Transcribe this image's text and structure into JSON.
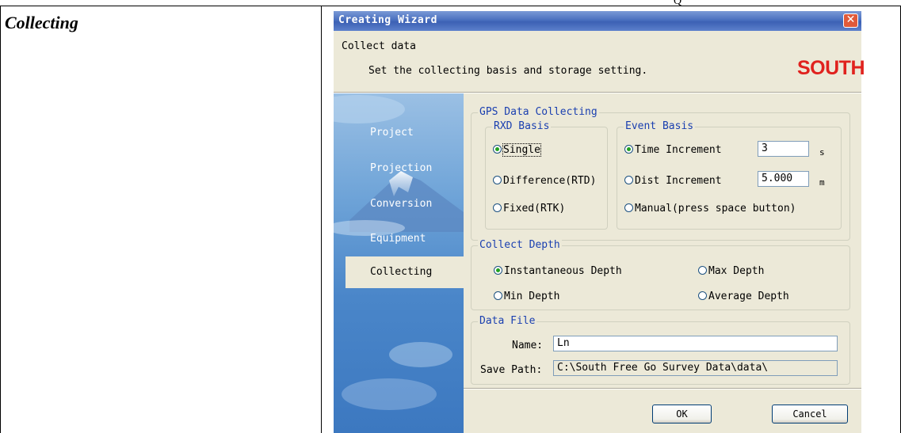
{
  "document": {
    "section_title": "Collecting",
    "top_fragment": "Q"
  },
  "dialog": {
    "title": "Creating Wizard",
    "close_glyph": "✕",
    "header_title": "Collect data",
    "header_subtitle": "Set the collecting basis and storage setting.",
    "logo_text": "SOUTH",
    "brand_color": "#e0221e",
    "nav": {
      "items": [
        {
          "label": "Project",
          "active": false
        },
        {
          "label": "Projection",
          "active": false
        },
        {
          "label": "Conversion",
          "active": false
        },
        {
          "label": "Equipment",
          "active": false
        },
        {
          "label": "Collecting",
          "active": true
        }
      ]
    },
    "gps": {
      "group_label": "GPS Data Collecting",
      "rxd": {
        "label": "RXD Basis",
        "options": [
          {
            "label": "Single",
            "selected": true
          },
          {
            "label": "Difference(RTD)",
            "selected": false
          },
          {
            "label": "Fixed(RTK)",
            "selected": false
          }
        ]
      },
      "event": {
        "label": "Event Basis",
        "time_label": "Time Increment",
        "time_value": "3",
        "time_unit": "s",
        "time_selected": true,
        "dist_label": "Dist Increment",
        "dist_value": "5.000",
        "dist_unit": "m",
        "manual_label": "Manual(press space button)"
      }
    },
    "depth": {
      "label": "Collect Depth",
      "instant": "Instantaneous Depth",
      "max": "Max Depth",
      "min": "Min Depth",
      "average": "Average Depth",
      "selected": "Instantaneous Depth"
    },
    "file": {
      "label": "Data File",
      "name_label": "Name:",
      "name_value": "Ln",
      "path_label": "Save Path:",
      "path_value": "C:\\South Free Go Survey Data\\data\\"
    },
    "buttons": {
      "ok": "OK",
      "cancel": "Cancel"
    }
  }
}
